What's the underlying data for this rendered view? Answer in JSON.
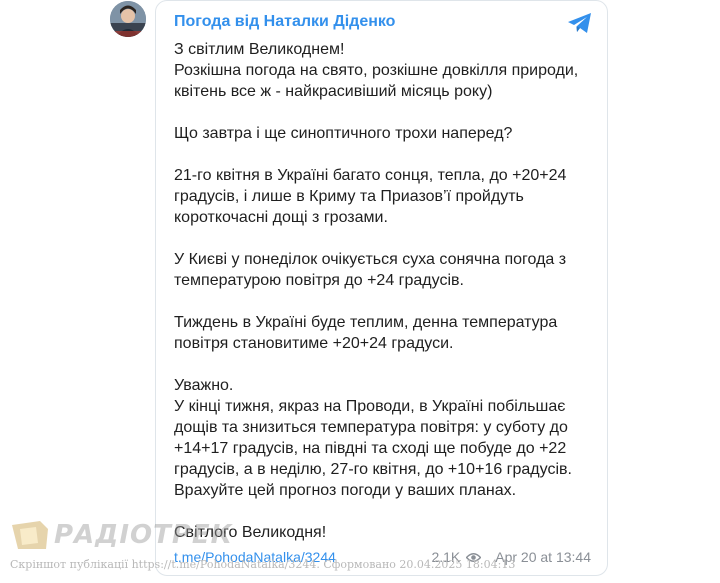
{
  "post": {
    "channel_name": "Погода від Наталки Діденко",
    "paragraphs": [
      [
        "З світлим Великоднем!",
        "Розкішна погода на свято, розкішне довкілля природи, квітень все ж - найкрасивіший місяць року)"
      ],
      [
        "Що завтра і ще синоптичного трохи наперед?"
      ],
      [
        "21-го квітня в Україні багато сонця, тепла, до +20+24 градусів, і лише в Криму та Приазов’ї пройдуть короткочасні дощі з грозами."
      ],
      [
        "У Києві у понеділок очікується суха сонячна погода з температурою повітря до +24 градусів."
      ],
      [
        "Тиждень в Україні буде теплим, денна температура повітря становитиме +20+24 градуси."
      ],
      [
        "Уважно.",
        "У кінці тижня, якраз на Проводи, в Україні побільшає дощів та знизиться температура повітря: у суботу до +14+17 градусів, на півдні та сході ще побуде до +22 градусів, а в неділю, 27-го квітня, до +10+16 градусів.",
        "Врахуйте цей прогноз погоди у ваших планах."
      ],
      [
        "Світлого Великодня!"
      ]
    ],
    "link": "t.me/PohodaNatalka/3244",
    "views": "2.1K",
    "timestamp": "Apr 20 at 13:44"
  },
  "icons": {
    "telegram": "telegram-icon",
    "views": "eye-icon"
  },
  "colors": {
    "accent": "#3390ec",
    "text": "#1f1f1f",
    "muted": "#8a8f96",
    "border": "#dfe5ea"
  },
  "watermark": {
    "logo_text": "РАДІОТРЕК",
    "caption": "Скріншот публікації https://t.me/PohodaNatalka/3244. Сформовано 20.04.2025 18:04:13"
  }
}
